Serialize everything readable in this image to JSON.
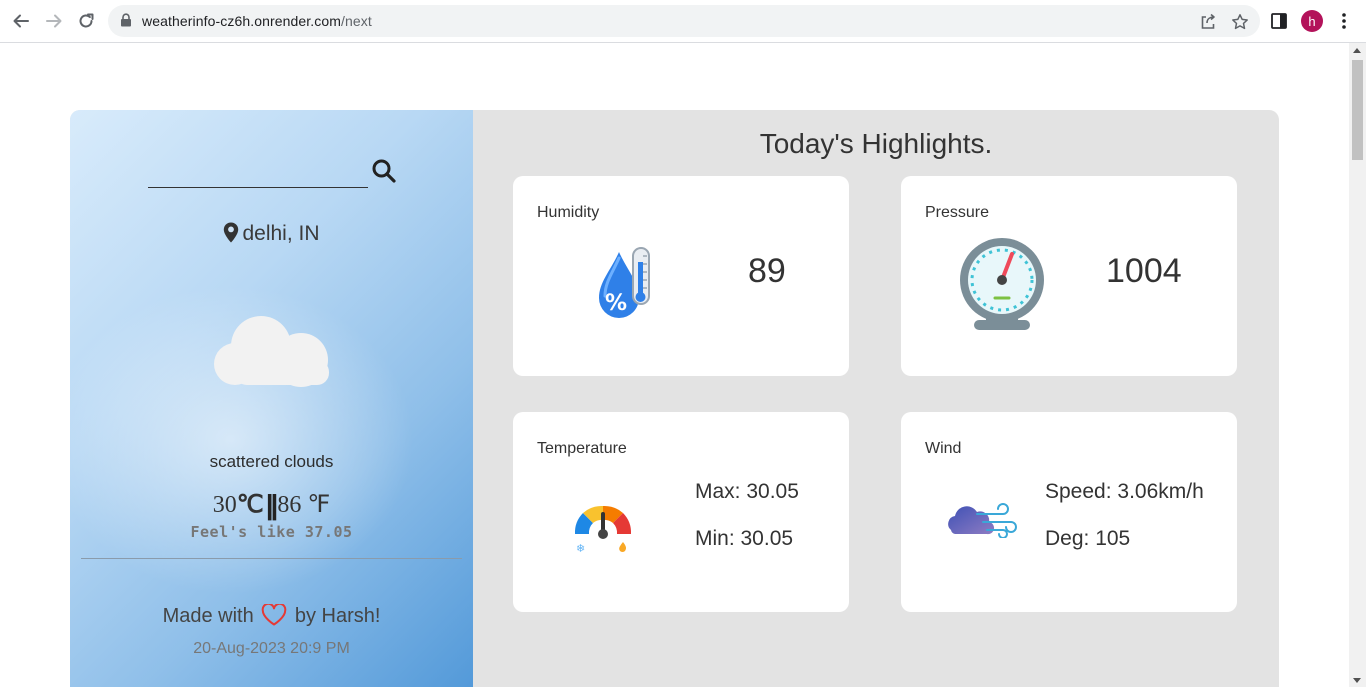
{
  "browser": {
    "url_host": "weatherinfo-cz6h.onrender.com",
    "url_path": "/next",
    "avatar_letter": "h"
  },
  "sidebar": {
    "search_placeholder": "",
    "location": "delhi, IN",
    "description": "scattered clouds",
    "temp_c": "30",
    "unit_c": "℃",
    "separator": "||",
    "temp_f": "86",
    "unit_f": "℉",
    "feels_like": "Feel's like 37.05",
    "made_prefix": "Made with",
    "made_suffix": "by Harsh!",
    "datetime": "20-Aug-2023 20:9 PM"
  },
  "highlights": {
    "title": "Today's Highlights.",
    "humidity": {
      "label": "Humidity",
      "value": "89"
    },
    "pressure": {
      "label": "Pressure",
      "value": "1004"
    },
    "temperature": {
      "label": "Temperature",
      "max": "Max: 30.05",
      "min": "Min: 30.05"
    },
    "wind": {
      "label": "Wind",
      "speed": "Speed: 3.06km/h",
      "deg": "Deg: 105"
    }
  },
  "colors": {
    "panel_bg": "#e3e3e3",
    "card_bg": "#ffffff",
    "sidebar_gradient_end": "#4f97d8",
    "heart": "#e53935"
  }
}
